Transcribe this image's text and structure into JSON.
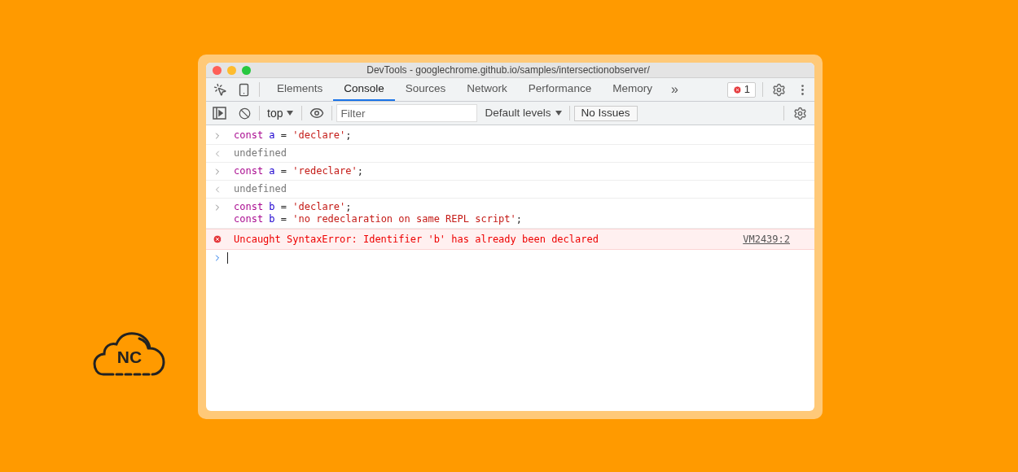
{
  "logo": {
    "text": "NC"
  },
  "window": {
    "title": "DevTools - googlechrome.github.io/samples/intersectionobserver/"
  },
  "tabs": [
    {
      "label": "Elements",
      "selected": false
    },
    {
      "label": "Console",
      "selected": true
    },
    {
      "label": "Sources",
      "selected": false
    },
    {
      "label": "Network",
      "selected": false
    },
    {
      "label": "Performance",
      "selected": false
    },
    {
      "label": "Memory",
      "selected": false
    }
  ],
  "more_tabs": "»",
  "error_badge": {
    "count": "1"
  },
  "toolbar": {
    "context": "top",
    "filter": {
      "placeholder": "Filter"
    },
    "levels": "Default levels",
    "issues": "No Issues"
  },
  "entries": [
    {
      "kind": "input",
      "lines": [
        [
          {
            "kind": "keyword",
            "text": "const"
          },
          {
            "kind": "ident",
            "text": " a"
          },
          {
            "kind": "plain",
            "text": " ="
          },
          {
            "kind": "string",
            "text": " 'declare'"
          },
          {
            "kind": "plain",
            "text": ";"
          }
        ]
      ]
    },
    {
      "kind": "output",
      "text": "undefined"
    },
    {
      "kind": "input",
      "lines": [
        [
          {
            "kind": "keyword",
            "text": "const"
          },
          {
            "kind": "ident",
            "text": " a"
          },
          {
            "kind": "plain",
            "text": " ="
          },
          {
            "kind": "string",
            "text": " 'redeclare'"
          },
          {
            "kind": "plain",
            "text": ";"
          }
        ]
      ]
    },
    {
      "kind": "output",
      "text": "undefined"
    },
    {
      "kind": "input",
      "lines": [
        [
          {
            "kind": "keyword",
            "text": "const"
          },
          {
            "kind": "ident",
            "text": " b"
          },
          {
            "kind": "plain",
            "text": " ="
          },
          {
            "kind": "string",
            "text": " 'declare'"
          },
          {
            "kind": "plain",
            "text": ";"
          }
        ],
        [
          {
            "kind": "keyword",
            "text": "const"
          },
          {
            "kind": "ident",
            "text": " b"
          },
          {
            "kind": "plain",
            "text": " ="
          },
          {
            "kind": "string",
            "text": " 'no redeclaration on same REPL script'"
          },
          {
            "kind": "plain",
            "text": ";"
          }
        ]
      ]
    },
    {
      "kind": "error",
      "text": "Uncaught SyntaxError: Identifier 'b' has already been declared",
      "source": "VM2439:2"
    }
  ]
}
